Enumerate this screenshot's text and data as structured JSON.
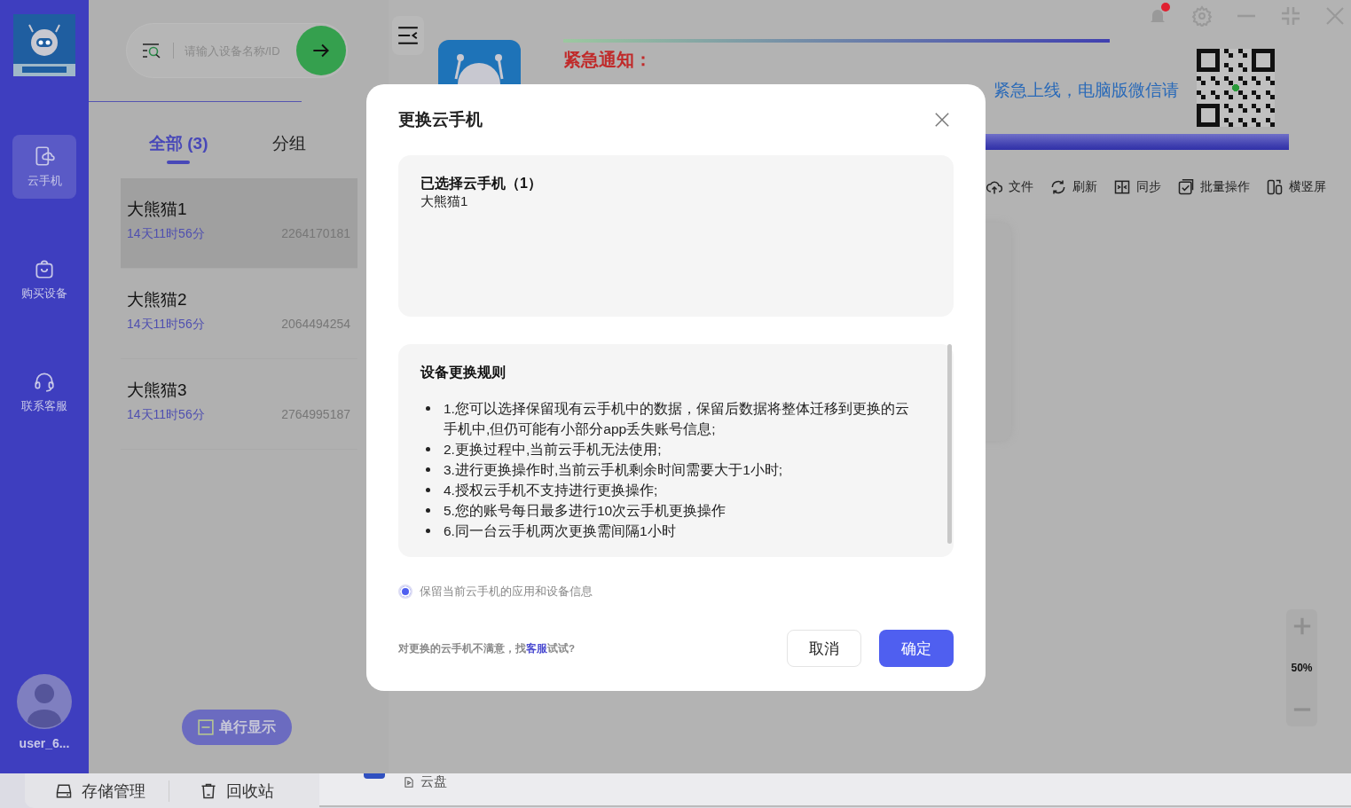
{
  "rail": {
    "items": [
      {
        "label": "云手机",
        "kind": "phone",
        "selected": true
      },
      {
        "label": "购买设备",
        "kind": "bag",
        "selected": false
      },
      {
        "label": "联系客服",
        "kind": "headset",
        "selected": false
      }
    ],
    "user": "user_6..."
  },
  "device_panel": {
    "search": {
      "placeholder": "请输入设备名称/ID"
    },
    "tabs": [
      {
        "label": "全部 (3)",
        "selected": true
      },
      {
        "label": "分组",
        "selected": false
      }
    ],
    "devices": [
      {
        "name": "大熊猫1",
        "remaining": "14天11时56分",
        "id": "2264170181",
        "selected": true
      },
      {
        "name": "大熊猫2",
        "remaining": "14天11时56分",
        "id": "2064494254",
        "selected": false
      },
      {
        "name": "大熊猫3",
        "remaining": "14天11时56分",
        "id": "2764995187",
        "selected": false
      }
    ],
    "view_button": "单行显示"
  },
  "window_controls": {
    "unread": true
  },
  "banner": {
    "title": "紧急通知：",
    "text": "紧急上线，电脑版微信请"
  },
  "toolbar": [
    {
      "label": "文件",
      "kind": "upload"
    },
    {
      "label": "刷新",
      "kind": "refresh"
    },
    {
      "label": "同步",
      "kind": "sync"
    },
    {
      "label": "批量操作",
      "kind": "batch"
    },
    {
      "label": "横竖屏",
      "kind": "rotate"
    }
  ],
  "zoom": {
    "value": "50%"
  },
  "bottom_bar": {
    "items": [
      {
        "label": "存储管理",
        "kind": "drive"
      },
      {
        "label": "回收站",
        "kind": "trash"
      }
    ],
    "cloud_disk": "云盘"
  },
  "dialog": {
    "title": "更换云手机",
    "selected_title": "已选择云手机（1）",
    "selected_devices": [
      "大熊猫1"
    ],
    "rules_title": "设备更换规则",
    "rules": [
      "1.您可以选择保留现有云手机中的数据，保留后数据将整体迁移到更换的云手机中,但仍可能有小部分app丢失账号信息;",
      "2.更换过程中,当前云手机无法使用;",
      "3.进行更换操作时,当前云手机剩余时间需要大于1小时;",
      "4.授权云手机不支持进行更换操作;",
      "5.您的账号每日最多进行10次云手机更换操作",
      "6.同一台云手机两次更换需间隔1小时"
    ],
    "keep_data": {
      "label": "保留当前云手机的应用和设备信息",
      "checked": true
    },
    "hint_before": "对更换的云手机不满意，找",
    "hint_link": "客服",
    "hint_after": "试试?",
    "buttons": [
      {
        "label": "取消",
        "kind": "secondary"
      },
      {
        "label": "确定",
        "kind": "primary"
      }
    ]
  }
}
